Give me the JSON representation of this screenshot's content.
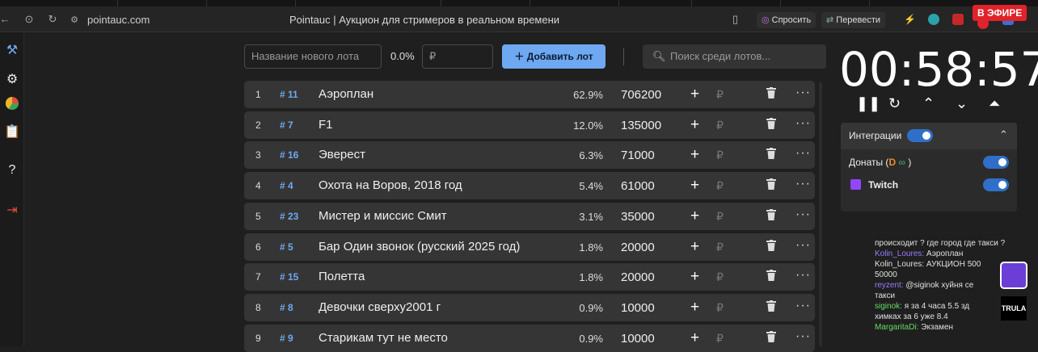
{
  "browser": {
    "url": "pointauc.com",
    "page_title": "Pointauc | Аукцион для стримеров в реальном времени",
    "ask_chip": "Спросить",
    "translate_chip": "Перевести",
    "live_badge": "В ЭФИРЕ"
  },
  "toolbar": {
    "new_lot_placeholder": "Название нового лота",
    "percent": "0.0%",
    "currency_placeholder": "₽",
    "add_button": "Добавить лот",
    "search_placeholder": "Поиск среди лотов..."
  },
  "lots": [
    {
      "index": "1",
      "id": "# 11",
      "name": "Аэроплан",
      "percent": "62.9%",
      "amount": "706200"
    },
    {
      "index": "2",
      "id": "# 7",
      "name": "F1",
      "percent": "12.0%",
      "amount": "135000"
    },
    {
      "index": "3",
      "id": "# 16",
      "name": "Эверест",
      "percent": "6.3%",
      "amount": "71000"
    },
    {
      "index": "4",
      "id": "# 4",
      "name": "Охота на Воров, 2018 год",
      "percent": "5.4%",
      "amount": "61000"
    },
    {
      "index": "5",
      "id": "# 23",
      "name": "Мистер и миссис Смит",
      "percent": "3.1%",
      "amount": "35000"
    },
    {
      "index": "6",
      "id": "# 5",
      "name": "Бар Один звонок (русский 2025 год)",
      "percent": "1.8%",
      "amount": "20000"
    },
    {
      "index": "7",
      "id": "# 15",
      "name": "Полетта",
      "percent": "1.8%",
      "amount": "20000"
    },
    {
      "index": "8",
      "id": "# 8",
      "name": "Девочки сверху2001 г",
      "percent": "0.9%",
      "amount": "10000"
    },
    {
      "index": "9",
      "id": "# 9",
      "name": "Старикам тут не место",
      "percent": "0.9%",
      "amount": "10000"
    }
  ],
  "row_symbols": {
    "plus": "+",
    "currency": "₽",
    "more": "···"
  },
  "timer": {
    "value": "00:58:57"
  },
  "integrations": {
    "title": "Интеграции",
    "donations_label": "Донаты (",
    "donations_suffix": ")",
    "twitch_label": "Twitch"
  },
  "chat": [
    {
      "user": "",
      "text": "происходит ? где город где такси ?"
    },
    {
      "user": "Kolin_Loures:",
      "text": "Аэроплан"
    },
    {
      "user": "",
      "text": "Kolin_Loures: АУКЦИОН 500"
    },
    {
      "user": "",
      "text": "50000"
    },
    {
      "user": "reyzent:",
      "text": "@siginok хуйня се"
    },
    {
      "user": "",
      "text": "такси"
    },
    {
      "user": "siginok:",
      "text": "я за 4 часа 5.5 зд"
    },
    {
      "user": "",
      "text": "химках за 6 уже 8.4"
    },
    {
      "user": "MargaritaDi:",
      "text": "Экзамен"
    }
  ],
  "overlay": {
    "badge": "TRULA"
  },
  "colors": {
    "accent": "#6ea8f0",
    "live": "#e1222a",
    "toggle": "#2f6fc8",
    "twitch": "#9146ff"
  }
}
